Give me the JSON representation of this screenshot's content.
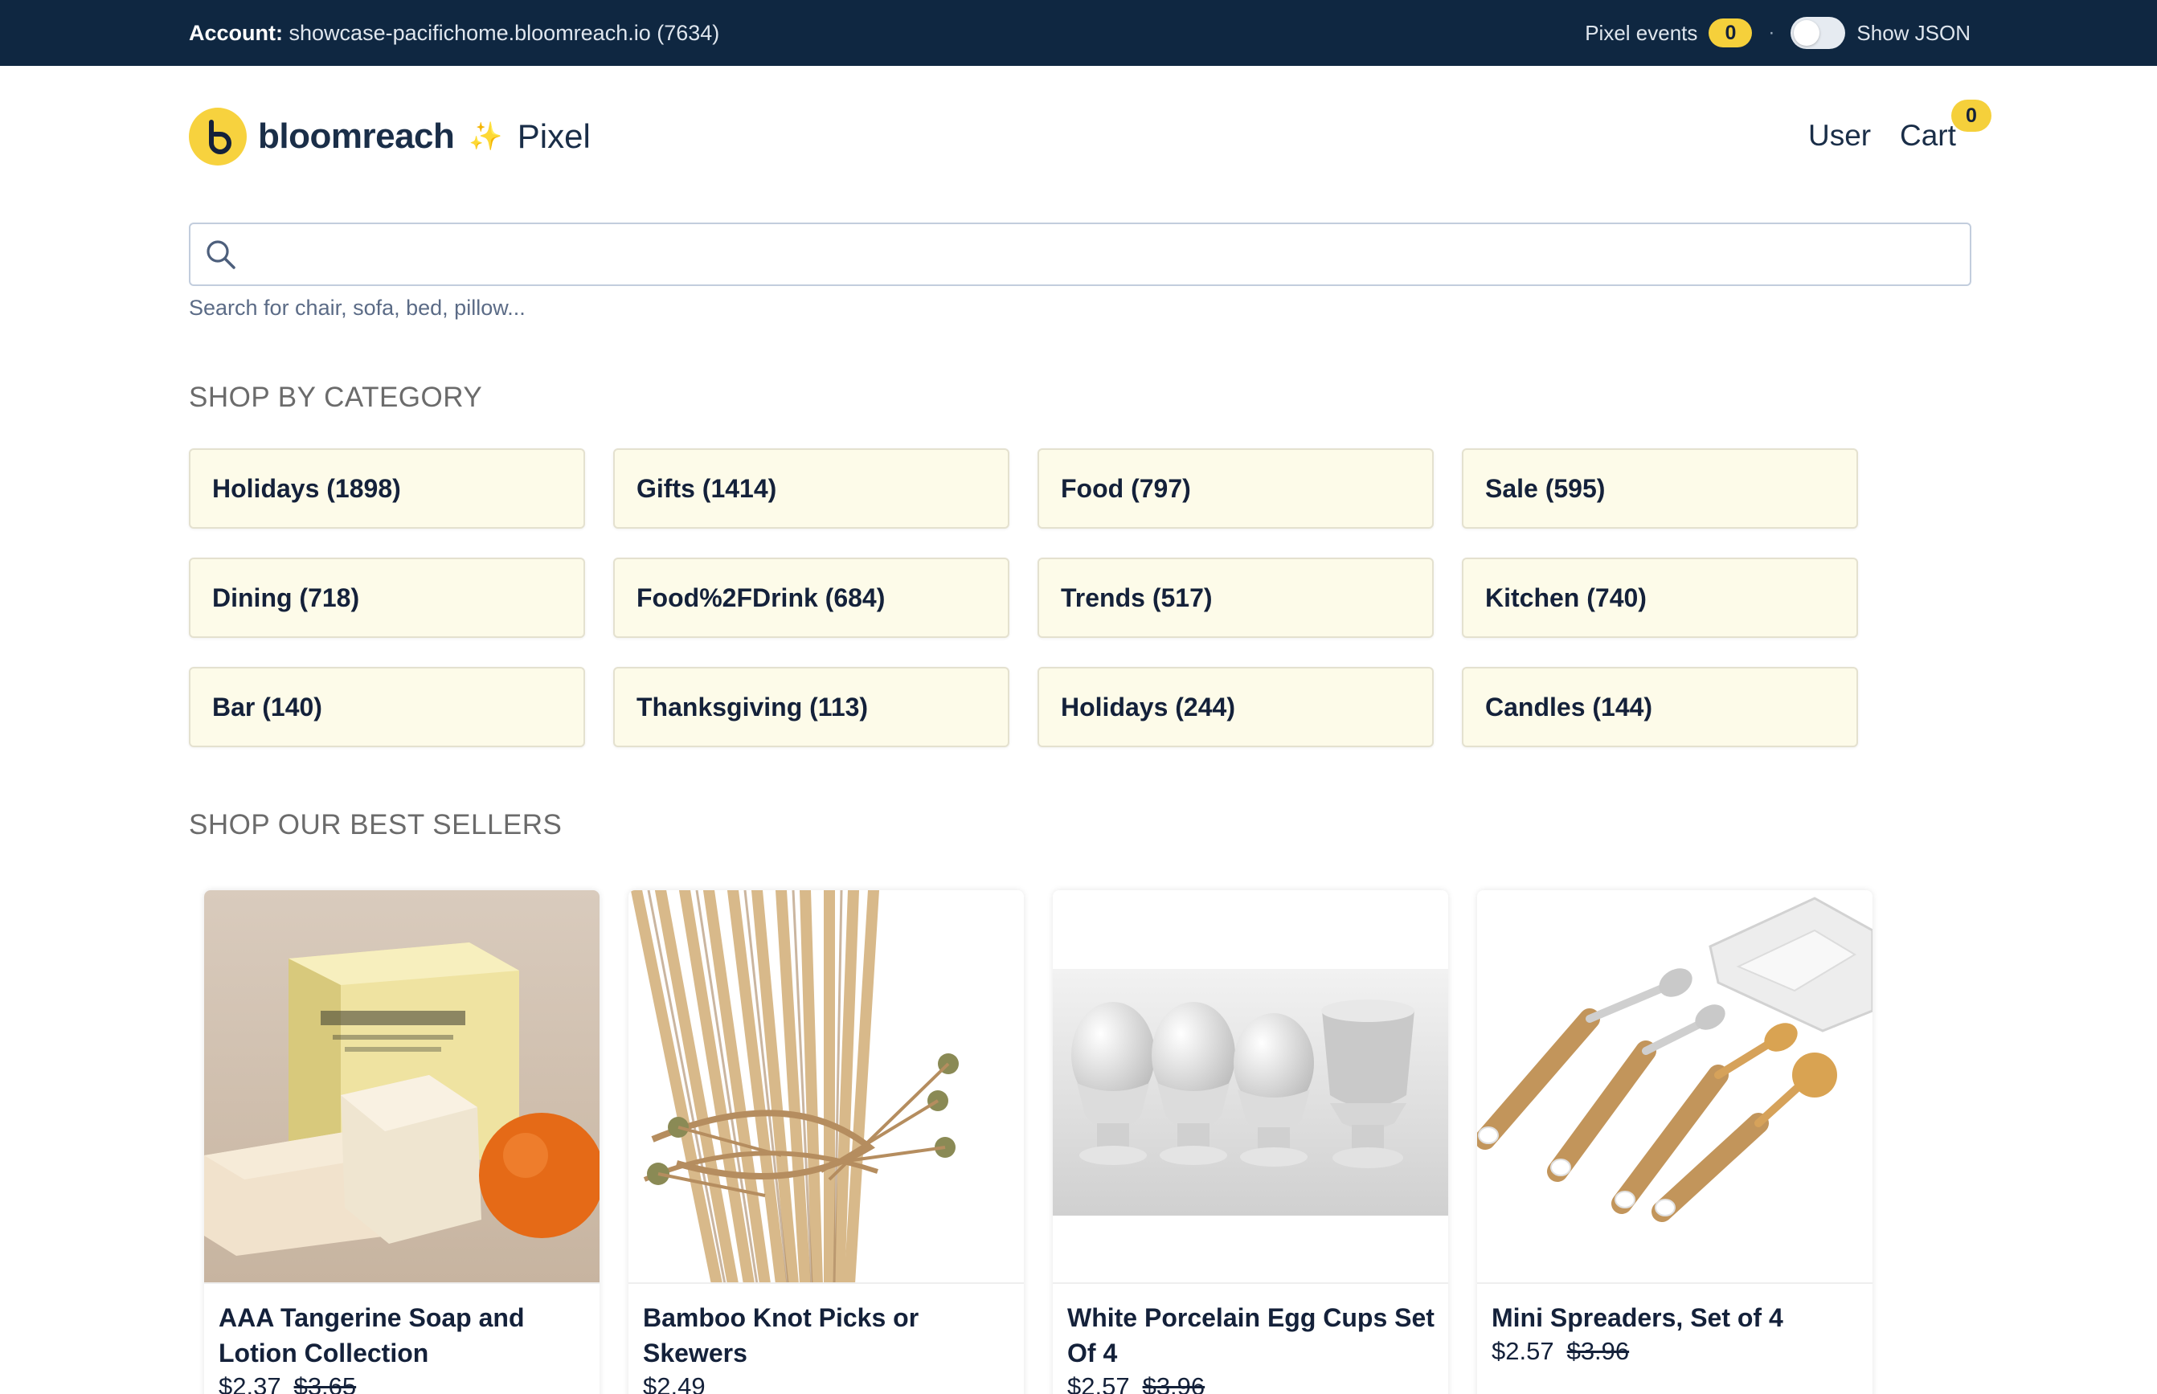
{
  "topbar": {
    "account_label": "Account:",
    "account_value": "showcase-pacifichome.bloomreach.io (7634)",
    "pixel_events_label": "Pixel events",
    "pixel_events_count": "0",
    "separator": "·",
    "show_json_label": "Show JSON",
    "show_json_enabled": false
  },
  "header": {
    "brand": "bloomreach",
    "sparkle": "✨",
    "product": "Pixel",
    "user_label": "User",
    "cart_label": "Cart",
    "cart_count": "0"
  },
  "search": {
    "value": "",
    "hint": "Search for chair, sofa, bed, pillow..."
  },
  "categories_section": {
    "title": "SHOP BY CATEGORY",
    "items": [
      {
        "label": "Holidays (1898)"
      },
      {
        "label": "Gifts (1414)"
      },
      {
        "label": "Food (797)"
      },
      {
        "label": "Sale (595)"
      },
      {
        "label": "Dining (718)"
      },
      {
        "label": "Food%2FDrink (684)"
      },
      {
        "label": "Trends (517)"
      },
      {
        "label": "Kitchen (740)"
      },
      {
        "label": "Bar (140)"
      },
      {
        "label": "Thanksgiving (113)"
      },
      {
        "label": "Holidays (244)"
      },
      {
        "label": "Candles (144)"
      }
    ]
  },
  "bestsellers_section": {
    "title": "SHOP OUR BEST SELLERS",
    "products": [
      {
        "name": "AAA Tangerine Soap and Lotion Collection",
        "price": "$2.37",
        "old_price": "$3.65"
      },
      {
        "name": "Bamboo Knot Picks or Skewers",
        "price": "$2.49",
        "old_price": ""
      },
      {
        "name": "White Porcelain Egg Cups Set Of 4",
        "price": "$2.57",
        "old_price": "$3.96"
      },
      {
        "name": "Mini Spreaders, Set of 4",
        "price": "$2.57",
        "old_price": "$3.96"
      }
    ]
  },
  "colors": {
    "topbar_bg": "#0f2741",
    "accent_yellow": "#f5d03b",
    "category_bg": "#fdfbe9",
    "text_dark": "#14213a"
  }
}
